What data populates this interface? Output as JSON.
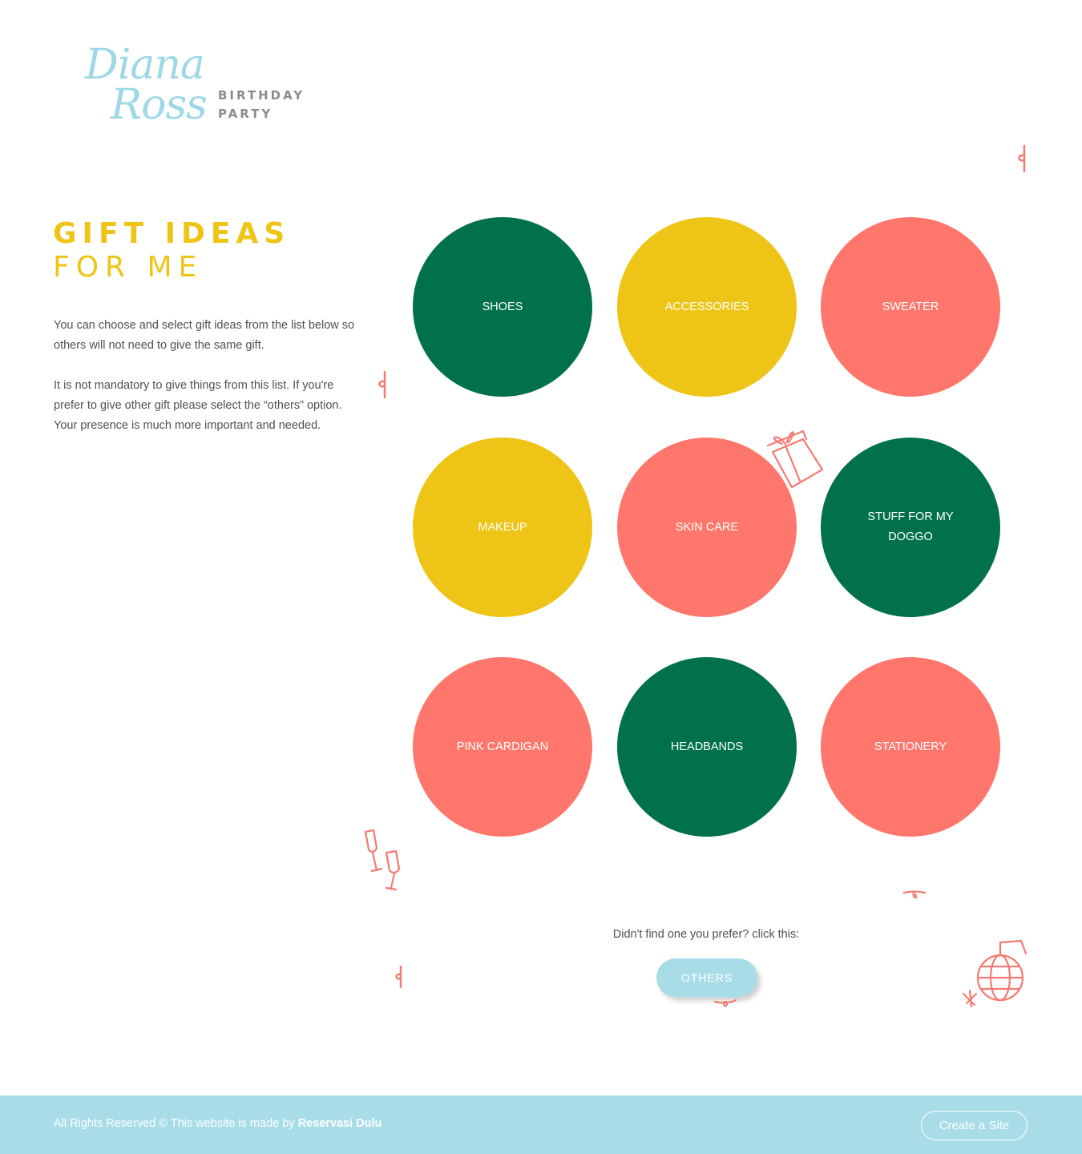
{
  "logo": {
    "script_line1": "Diana",
    "script_line2": "Ross",
    "sub_line1": "BIRTHDAY",
    "sub_line2": "PARTY"
  },
  "heading": {
    "line1": "GIFT IDEAS",
    "line2": "FOR ME"
  },
  "intro": {
    "paragraph1": "You can choose and select gift ideas from the list below so others will not need to give the same gift.",
    "paragraph2": "It is not mandatory to give things from this list. If you're prefer to give other gift please select the “others” option. Your presence is much more important and needed."
  },
  "gifts": [
    {
      "label": "SHOES",
      "color": "#00714c"
    },
    {
      "label": "ACCESSORIES",
      "color": "#eec516"
    },
    {
      "label": "SWEATER",
      "color": "#ff776c"
    },
    {
      "label": "MAKEUP",
      "color": "#eec516"
    },
    {
      "label": "SKIN CARE",
      "color": "#ff776c"
    },
    {
      "label": "STUFF FOR MY DOGGO",
      "color": "#00714c"
    },
    {
      "label": "PINK CARDIGAN",
      "color": "#ff776c"
    },
    {
      "label": "HEADBANDS",
      "color": "#00714c"
    },
    {
      "label": "STATIONERY",
      "color": "#ff776c"
    }
  ],
  "others": {
    "prompt": "Didn't find one you prefer? click this:",
    "button_label": "OTHERS"
  },
  "footer": {
    "text": "All Rights Reserved © This website is made by",
    "brand": "Reservasi Dulu",
    "create_button": "Create a Site"
  },
  "colors": {
    "green": "#00714c",
    "yellow": "#eec516",
    "coral": "#ff776c",
    "light_blue": "#a8dde8"
  }
}
